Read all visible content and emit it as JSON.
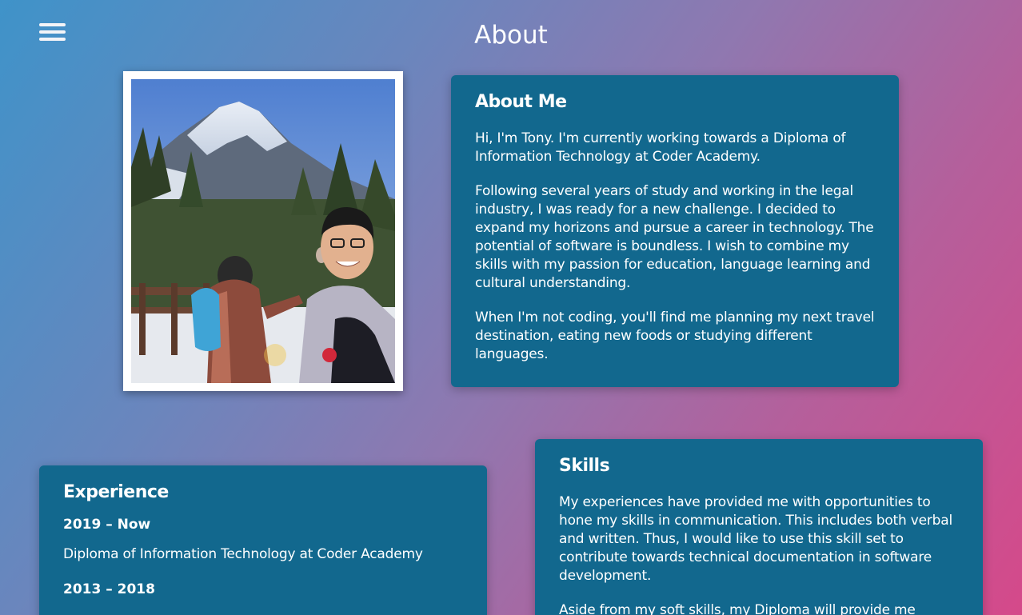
{
  "header": {
    "title": "About",
    "menu_icon": "hamburger-menu-icon"
  },
  "photo": {
    "alt": "Tony at a mountain lookout"
  },
  "about": {
    "heading": "About Me",
    "paragraphs": [
      "Hi, I'm Tony. I'm currently working towards a Diploma of Information Technology at Coder Academy.",
      "Following several years of study and working in the legal industry, I was ready for a new challenge. I decided to expand my horizons and pursue a career in technology. The potential of software is boundless. I wish to combine my skills with my passion for education, language learning and cultural understanding.",
      "When I'm not coding, you'll find me planning my next travel destination, eating new foods or studying different languages."
    ]
  },
  "experience": {
    "heading": "Experience",
    "entries": [
      {
        "period": "2019 – Now",
        "description": "Diploma of Information Technology at Coder Academy"
      },
      {
        "period": "2013 – 2018",
        "description": ""
      }
    ]
  },
  "skills": {
    "heading": "Skills",
    "paragraphs": [
      "My experiences have provided me with opportunities to hone my skills in communication. This includes both verbal and written. Thus, I would like to use this skill set to contribute towards technical documentation in software development.",
      "Aside from my soft skills, my Diploma will provide me"
    ]
  },
  "colors": {
    "card_background": "#12688e",
    "gradient_start": "#3f93c9",
    "gradient_end": "#d5498a",
    "text": "#ffffff"
  }
}
